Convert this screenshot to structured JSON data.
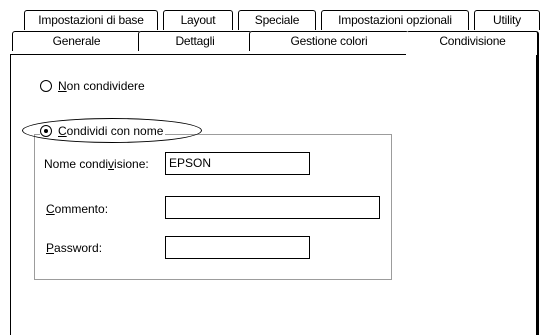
{
  "tabs_back": [
    {
      "label": "Impostazioni di base"
    },
    {
      "label": "Layout"
    },
    {
      "label": "Speciale"
    },
    {
      "label": "Impostazioni opzionali"
    },
    {
      "label": "Utility"
    }
  ],
  "tabs_front": [
    {
      "label": "Generale"
    },
    {
      "label": "Dettagli"
    },
    {
      "label": "Gestione colori"
    },
    {
      "label": "Condivisione"
    }
  ],
  "sharing": {
    "not_shared": {
      "pre": "",
      "accel": "N",
      "post": "on condividere",
      "selected": false
    },
    "shared_as": {
      "pre": "",
      "accel": "C",
      "post": "ondividi con nome",
      "selected": true
    },
    "share_name": {
      "pre": "Nome condi",
      "accel": "v",
      "post": "isione:",
      "value": "EPSON"
    },
    "comment": {
      "pre": "",
      "accel": "C",
      "post": "ommento:",
      "value": ""
    },
    "password": {
      "pre": "",
      "accel": "P",
      "post": "assword:",
      "value": ""
    }
  }
}
